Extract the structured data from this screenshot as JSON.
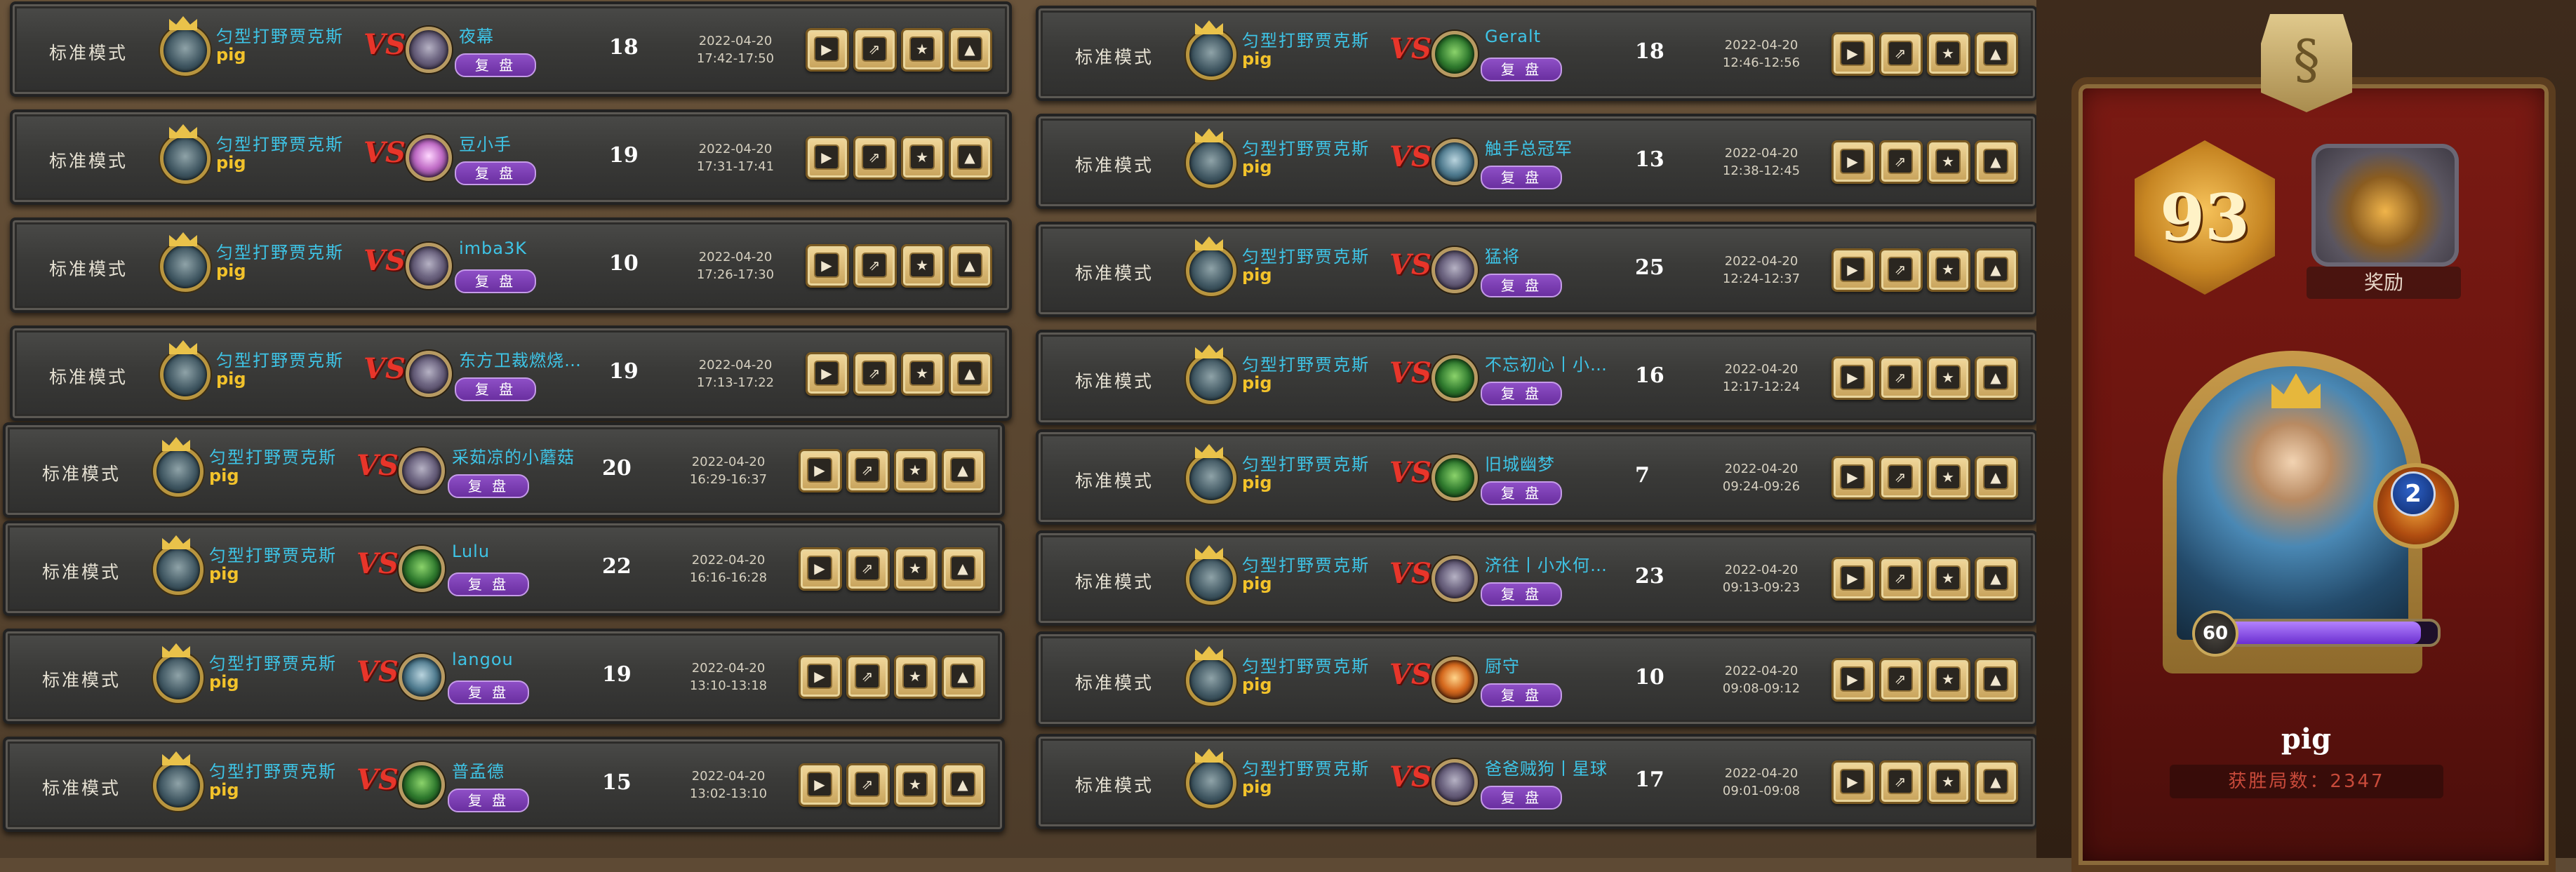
{
  "mode_label": "标准模式",
  "player": {
    "name": "匀型打野贾克斯",
    "account": "pig"
  },
  "vs_label": "VS",
  "replay_label": "复 盘",
  "left_rows": [
    {
      "opponent": "夜幕",
      "turns": "18",
      "date": "2022-04-20",
      "time": "17:42-17:50",
      "opp_color": "grey"
    },
    {
      "opponent": "豆小手",
      "turns": "19",
      "date": "2022-04-20",
      "time": "17:31-17:41",
      "opp_color": "pink"
    },
    {
      "opponent": "imba3K",
      "turns": "10",
      "date": "2022-04-20",
      "time": "17:26-17:30",
      "opp_color": "grey"
    },
    {
      "opponent": "东方卫裁燃烧…",
      "turns": "19",
      "date": "2022-04-20",
      "time": "17:13-17:22",
      "opp_color": "grey"
    },
    {
      "opponent": "采茹凉的小蘑菇",
      "turns": "20",
      "date": "2022-04-20",
      "time": "16:29-16:37",
      "opp_color": "grey"
    },
    {
      "opponent": "Lulu",
      "turns": "22",
      "date": "2022-04-20",
      "time": "16:16-16:28",
      "opp_color": "green"
    },
    {
      "opponent": "langou",
      "turns": "19",
      "date": "2022-04-20",
      "time": "13:10-13:18",
      "opp_color": "blue"
    },
    {
      "opponent": "普孟德",
      "turns": "15",
      "date": "2022-04-20",
      "time": "13:02-13:10",
      "opp_color": "green"
    }
  ],
  "right_rows": [
    {
      "opponent": "Geralt",
      "turns": "18",
      "date": "2022-04-20",
      "time": "12:46-12:56",
      "opp_color": "green"
    },
    {
      "opponent": "触手总冠军",
      "turns": "13",
      "date": "2022-04-20",
      "time": "12:38-12:45",
      "opp_color": "blue"
    },
    {
      "opponent": "猛将",
      "turns": "25",
      "date": "2022-04-20",
      "time": "12:24-12:37",
      "opp_color": "grey"
    },
    {
      "opponent": "不忘初心丨小…",
      "turns": "16",
      "date": "2022-04-20",
      "time": "12:17-12:24",
      "opp_color": "green"
    },
    {
      "opponent": "旧城幽梦",
      "turns": "7",
      "date": "2022-04-20",
      "time": "09:24-09:26",
      "opp_color": "green"
    },
    {
      "opponent": "济往丨小水何…",
      "turns": "23",
      "date": "2022-04-20",
      "time": "09:13-09:23",
      "opp_color": "grey"
    },
    {
      "opponent": "厨守",
      "turns": "10",
      "date": "2022-04-20",
      "time": "09:08-09:12",
      "opp_color": "orange"
    },
    {
      "opponent": "爸爸贼狗丨星球",
      "turns": "17",
      "date": "2022-04-20",
      "time": "09:01-09:08",
      "opp_color": "grey"
    }
  ],
  "action_buttons": [
    {
      "name": "play-button",
      "icon": "▶"
    },
    {
      "name": "share-button",
      "icon": "⇗"
    },
    {
      "name": "favorite-button",
      "icon": "★"
    },
    {
      "name": "warning-button",
      "icon": "▲"
    }
  ],
  "profile": {
    "emblem_icon": "§",
    "level": "93",
    "reward_label": "奖励",
    "armor": "2",
    "hero_level": "60",
    "xp_fraction": 0.92,
    "player_name": "pig",
    "wins_text": "获胜局数：2347"
  }
}
